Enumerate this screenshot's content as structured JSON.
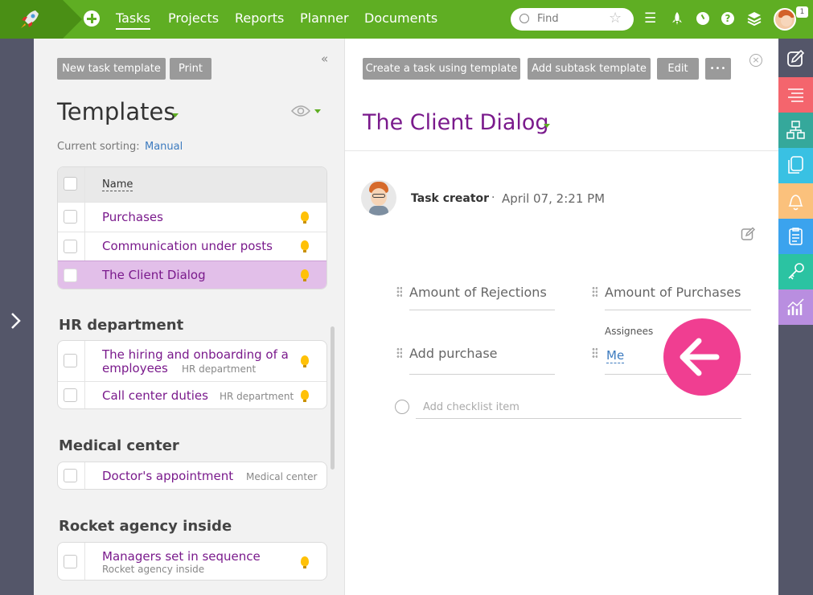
{
  "topbar": {
    "nav": [
      "Tasks",
      "Projects",
      "Reports",
      "Planner",
      "Documents"
    ],
    "search_placeholder": "Find",
    "badge": "1"
  },
  "left": {
    "new_template_btn": "New task template",
    "print_btn": "Print",
    "title": "Templates",
    "sorting_label": "Current sorting:",
    "sorting_value": "Manual",
    "col_name": "Name",
    "general": [
      "Purchases",
      "Communication under posts",
      "The Client Dialog"
    ],
    "groups": [
      {
        "name": "HR department",
        "items": [
          {
            "title_line1": "The hiring and onboarding of a",
            "title_line2": "employees",
            "sub": "HR department"
          },
          {
            "title": "Call center duties",
            "sub": "HR department"
          }
        ]
      },
      {
        "name": "Medical center",
        "items": [
          {
            "title": "Doctor's appointment",
            "sub": "Medical center"
          }
        ]
      },
      {
        "name": "Rocket agency inside",
        "items": [
          {
            "title": "Managers set in sequence",
            "sub": "Rocket agency inside"
          }
        ]
      }
    ]
  },
  "detail": {
    "create_btn": "Create a task using template",
    "add_sub_btn": "Add subtask template",
    "edit_btn": "Edit",
    "more_btn": "•••",
    "title": "The Client Dialog",
    "creator_label": "Task creator",
    "sep": "·",
    "date": "April 07, 2:21 PM",
    "field1": "Amount of Rejections",
    "field2": "Amount of Purchases",
    "field3": "Add purchase",
    "assignees_label": "Assignees",
    "assignee": "Me",
    "checklist_placeholder": "Add checklist item"
  },
  "colors": {
    "green": "#5fae23",
    "purple": "#7a1a8c",
    "pink": "#f03e91"
  }
}
